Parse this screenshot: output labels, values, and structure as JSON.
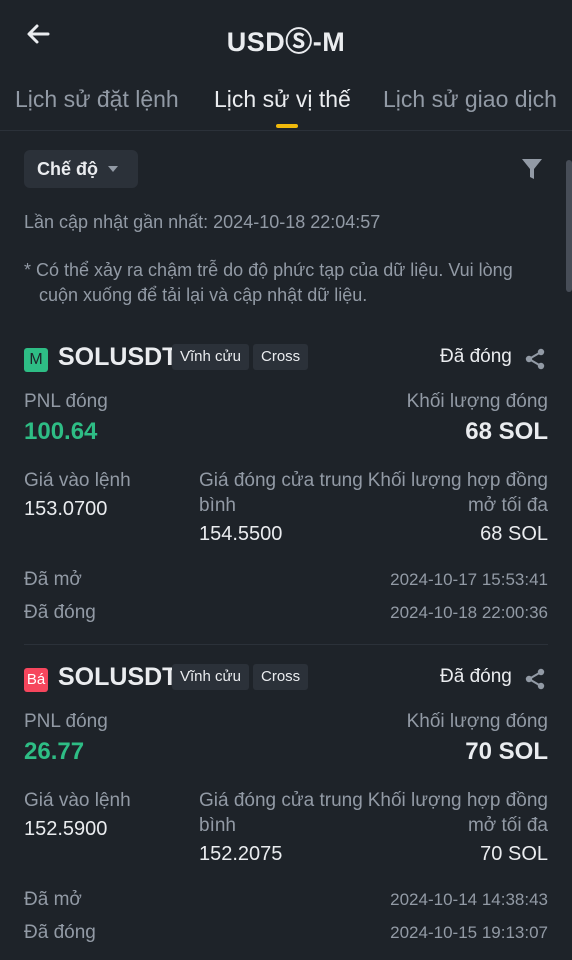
{
  "header": {
    "title": "USDⓈ-M",
    "back_icon": "arrow-left-icon"
  },
  "tabs": [
    {
      "label": "Lịch sử đặt lệnh",
      "active": false
    },
    {
      "label": "Lịch sử vị thế",
      "active": true
    },
    {
      "label": "Lịch sử giao dịch",
      "active": false
    }
  ],
  "filter": {
    "mode_label": "Chế độ",
    "filter_icon": "funnel-icon"
  },
  "updated_text": "Lần cập nhật gần nhất: 2024-10-18 22:04:57",
  "note": {
    "line1": "* Có thể xảy ra chậm trễ do độ phức tạp của dữ liệu. Vui lòng",
    "line2": "cuộn xuống để tải lại và cập nhật dữ liệu."
  },
  "colors": {
    "background": "#1e2329",
    "accent": "#f0b90b",
    "profit": "#2ebd85",
    "sell": "#f6465d",
    "muted": "#929aa5"
  },
  "positions": [
    {
      "side_badge": "M",
      "symbol": "SOLUSDT",
      "tag_type": "Vĩnh cửu",
      "tag_margin": "Cross",
      "status": "Đã đóng",
      "pnl_label": "PNL đóng",
      "pnl_value": "100.64",
      "close_vol_label": "Khối lượng đóng",
      "close_vol_value": "68 SOL",
      "entry_label": "Giá vào lệnh",
      "entry_value": "153.0700",
      "avg_close_label_1": "Giá đóng cửa trung",
      "avg_close_label_2": "bình",
      "avg_close_value": "154.5500",
      "max_oi_label_1": "Khối lượng hợp đồng",
      "max_oi_label_2": "mở tối đa",
      "max_oi_value": "68 SOL",
      "opened_label": "Đã mở",
      "opened_value": "2024-10-17 15:53:41",
      "closed_label": "Đã đóng",
      "closed_value": "2024-10-18 22:00:36"
    },
    {
      "side_badge": "Bá",
      "symbol": "SOLUSDT",
      "tag_type": "Vĩnh cửu",
      "tag_margin": "Cross",
      "status": "Đã đóng",
      "pnl_label": "PNL đóng",
      "pnl_value": "26.77",
      "close_vol_label": "Khối lượng đóng",
      "close_vol_value": "70 SOL",
      "entry_label": "Giá vào lệnh",
      "entry_value": "152.5900",
      "avg_close_label_1": "Giá đóng cửa trung",
      "avg_close_label_2": "bình",
      "avg_close_value": "152.2075",
      "max_oi_label_1": "Khối lượng hợp đồng",
      "max_oi_label_2": "mở tối đa",
      "max_oi_value": "70 SOL",
      "opened_label": "Đã mở",
      "opened_value": "2024-10-14 14:38:43",
      "closed_label": "Đã đóng",
      "closed_value": "2024-10-15 19:13:07"
    }
  ]
}
